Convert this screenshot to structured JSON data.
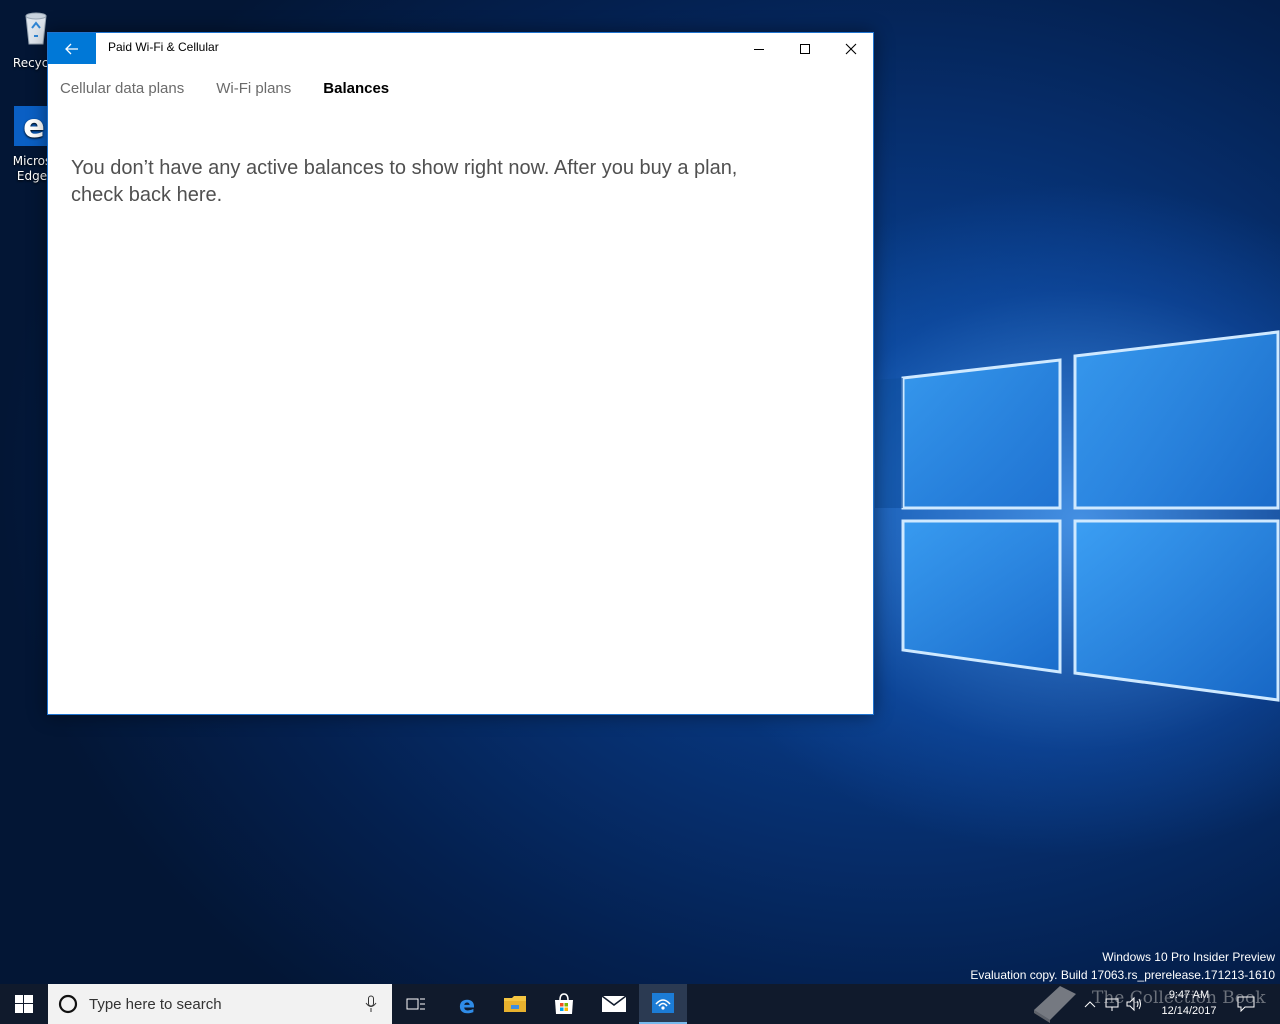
{
  "desktop": {
    "icons": [
      {
        "label": "Recycle",
        "icon": "recycle-bin-icon"
      },
      {
        "label": "Micros Edge",
        "icon": "edge-icon"
      }
    ]
  },
  "window": {
    "title": "Paid Wi-Fi & Cellular",
    "tabs": [
      {
        "label": "Cellular data plans",
        "active": false
      },
      {
        "label": "Wi-Fi plans",
        "active": false
      },
      {
        "label": "Balances",
        "active": true
      }
    ],
    "message": "You don’t have any active balances to show right now. After you buy a plan, check back here."
  },
  "watermark": {
    "line1": "Windows 10 Pro Insider Preview",
    "line2": "Evaluation copy. Build 17063.rs_prerelease.171213-1610"
  },
  "taskbar": {
    "search_placeholder": "Type here to search",
    "apps": [
      "task-view-icon",
      "edge-icon",
      "file-explorer-icon",
      "store-icon",
      "mail-icon",
      "paid-wifi-icon"
    ],
    "time": "9:47 AM",
    "date": "12/14/2017"
  },
  "overlay_watermark": "The Collection Book",
  "colors": {
    "accent": "#0078d7",
    "taskbar": "#101a2c"
  }
}
